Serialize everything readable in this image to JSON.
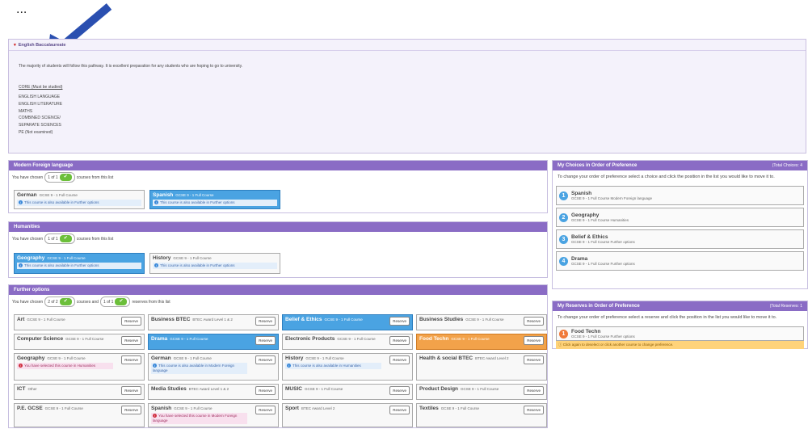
{
  "annotation": {
    "note_text": "..."
  },
  "ebacc": {
    "title": "English Baccalaureate",
    "intro": "The majority of students will follow this pathway. It is excellent preparation for any students who are hoping to go to university.",
    "core_label": "CORE (Must be studied)",
    "subjects": [
      "ENGLISH LANGUAGE",
      "ENGLISH LITERATURE",
      "",
      "MATHS",
      "",
      "COMBINED SCIENCE/",
      "SEPARATE SCIENCES",
      "",
      "PE (Not examined)"
    ]
  },
  "mfl": {
    "title": "Modern Foreign language",
    "chosen_prefix": "You have chosen",
    "chosen_count": "1 of 1",
    "chosen_suffix": "courses from this list",
    "cards": [
      {
        "name": "German",
        "detail": "GCSE 9 - 1 Full Course",
        "note": "This course is also available in Further options"
      },
      {
        "name": "Spanish",
        "detail": "GCSE 9 - 1 Full Course",
        "note": "This course is also available in Further options"
      }
    ]
  },
  "hum": {
    "title": "Humanities",
    "chosen_prefix": "You have chosen",
    "chosen_count": "1 of 1",
    "chosen_suffix": "courses from this list",
    "cards": [
      {
        "name": "Geography",
        "detail": "GCSE 9 - 1 Full Course",
        "note": "This course is also available in Further options"
      },
      {
        "name": "History",
        "detail": "GCSE 9 - 1 Full Course",
        "note": "This course is also available in Further options"
      }
    ]
  },
  "further": {
    "title": "Further options",
    "chosen_prefix": "You have chosen",
    "chosen_count": "2 of 2",
    "mid": "courses and",
    "reserve_count": "1 of 1",
    "chosen_suffix": "reserves from this list",
    "reserve_label": "Reserve",
    "cards": [
      {
        "name": "Art",
        "detail": "GCSE 9 - 1 Full Course"
      },
      {
        "name": "Business BTEC",
        "detail": "BTEC Award Level 1 & 2"
      },
      {
        "name": "Belief & Ethics",
        "detail": "GCSE 9 - 1 Full Course"
      },
      {
        "name": "Business Studies",
        "detail": "GCSE 9 - 1 Full Course"
      },
      {
        "name": "Computer Science",
        "detail": "GCSE 9 - 1 Full Course"
      },
      {
        "name": "Drama",
        "detail": "GCSE 9 - 1 Full Course"
      },
      {
        "name": "Electronic Products",
        "detail": "GCSE 9 - 1 Full Course"
      },
      {
        "name": "Food Techn",
        "detail": "GCSE 9 - 1 Full Course"
      },
      {
        "name": "Geography",
        "detail": "GCSE 9 - 1 Full Course",
        "note": "You have selected this course in Humanities"
      },
      {
        "name": "German",
        "detail": "GCSE 9 - 1 Full Course",
        "note": "This course is also available in Modern Foreign language"
      },
      {
        "name": "History",
        "detail": "GCSE 9 - 1 Full Course",
        "note": "This course is also available in Humanities"
      },
      {
        "name": "Health & social BTEC",
        "detail": "BTEC Award Level 2"
      },
      {
        "name": "ICT",
        "detail": "Other"
      },
      {
        "name": "Media Studies",
        "detail": "BTEC Award Level 1 & 2"
      },
      {
        "name": "MUSIC",
        "detail": "GCSE 9 - 1 Full Course"
      },
      {
        "name": "Product Design",
        "detail": "GCSE 9 - 1 Full Course"
      },
      {
        "name": "P.E. GCSE",
        "detail": "GCSE 9 - 1 Full Course"
      },
      {
        "name": "Spanish",
        "detail": "GCSE 9 - 1 Full Course",
        "note": "You have selected this course in Modern Foreign language"
      },
      {
        "name": "Sport",
        "detail": "BTEC Award Level 2"
      },
      {
        "name": "Textiles",
        "detail": "GCSE 9 - 1 Full Course"
      }
    ]
  },
  "choices": {
    "title": "My Choices in Order of Preference",
    "total": "(Total Choices: 4",
    "instr": "To change your order of preference select a choice and click the position in the list you would like to move it to.",
    "items": [
      {
        "num": "1",
        "name": "Spanish",
        "detail": "GCSE 9 - 1 Full Course Modern Foreign language"
      },
      {
        "num": "2",
        "name": "Geography",
        "detail": "GCSE 9 - 1 Full Course Humanities"
      },
      {
        "num": "3",
        "name": "Belief & Ethics",
        "detail": "GCSE 9 - 1 Full Course Further options"
      },
      {
        "num": "4",
        "name": "Drama",
        "detail": "GCSE 9 - 1 Full Course Further options"
      }
    ]
  },
  "reserves": {
    "title": "My Reserves in Order of Preference",
    "total": "(Total Reserves: 1",
    "instr": "To change your order of preference select a reserve and click the position in the list you would like to move it to.",
    "items": [
      {
        "num": "1",
        "name": "Food Techn",
        "detail": "GCSE 9 - 1 Full Course Further options"
      }
    ],
    "warn": "Click again to deselect or click another course to change preference."
  }
}
